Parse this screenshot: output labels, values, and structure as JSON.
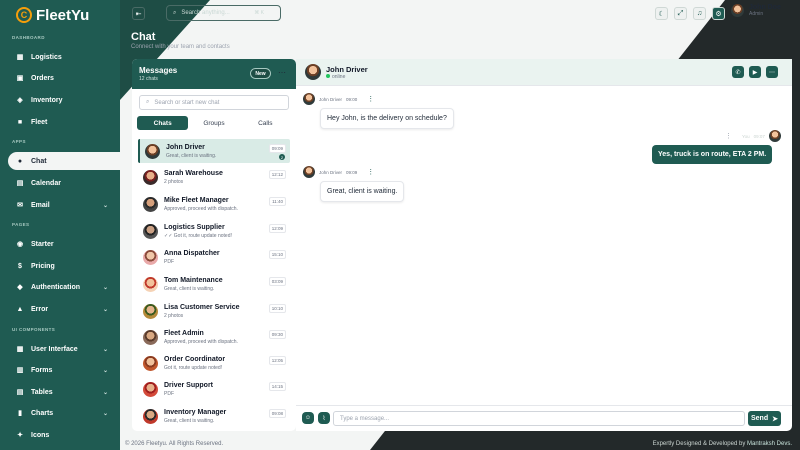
{
  "brand": {
    "name": "FleetYu",
    "mark": "C"
  },
  "sidebar": {
    "sections": [
      "DASHBOARD",
      "APPS",
      "PAGES",
      "UI COMPONENTS"
    ],
    "items": [
      {
        "label": "Logistics",
        "icon": "building-icon"
      },
      {
        "label": "Orders",
        "icon": "box-icon"
      },
      {
        "label": "Inventory",
        "icon": "layers-icon"
      },
      {
        "label": "Fleet",
        "icon": "truck-icon"
      },
      {
        "label": "Chat",
        "icon": "chat-icon",
        "active": true
      },
      {
        "label": "Calendar",
        "icon": "calendar-icon"
      },
      {
        "label": "Email",
        "icon": "mail-icon",
        "expandable": true
      },
      {
        "label": "Starter",
        "icon": "rocket-icon"
      },
      {
        "label": "Pricing",
        "icon": "dollar-icon"
      },
      {
        "label": "Authentication",
        "icon": "shield-icon",
        "expandable": true
      },
      {
        "label": "Error",
        "icon": "alert-icon",
        "expandable": true
      },
      {
        "label": "User Interface",
        "icon": "grid-icon",
        "expandable": true
      },
      {
        "label": "Forms",
        "icon": "form-icon",
        "expandable": true
      },
      {
        "label": "Tables",
        "icon": "table-icon",
        "expandable": true
      },
      {
        "label": "Charts",
        "icon": "chart-icon",
        "expandable": true
      },
      {
        "label": "Icons",
        "icon": "star-icon"
      }
    ]
  },
  "topbar": {
    "search_placeholder": "Search anything...",
    "shortcut": "⌘ K",
    "user": {
      "name": "John Doe",
      "role": "Admin"
    }
  },
  "page": {
    "title": "Chat",
    "subtitle": "Connect with your team and contacts"
  },
  "messages_panel": {
    "title": "Messages",
    "subtitle": "12 chats",
    "new_label": "New",
    "search_placeholder": "Search or start new chat",
    "tabs": [
      "Chats",
      "Groups",
      "Calls"
    ],
    "conversations": [
      {
        "name": "John Driver",
        "preview": "Great, client is waiting.",
        "time": "09:09",
        "badge": "2",
        "selected": true
      },
      {
        "name": "Sarah Warehouse",
        "preview": "2 photos",
        "time": "12:12"
      },
      {
        "name": "Mike Fleet Manager",
        "preview": "Approved, proceed with dispatch.",
        "time": "11:40"
      },
      {
        "name": "Logistics Supplier",
        "preview": "✓✓ Got it, route update noted!",
        "time": "12:09"
      },
      {
        "name": "Anna Dispatcher",
        "preview": "PDF",
        "time": "15:10"
      },
      {
        "name": "Tom Maintenance",
        "preview": "Great, client is waiting.",
        "time": "03:09"
      },
      {
        "name": "Lisa Customer Service",
        "preview": "2 photos",
        "time": "10:10"
      },
      {
        "name": "Fleet Admin",
        "preview": "Approved, proceed with dispatch.",
        "time": "09:30"
      },
      {
        "name": "Order Coordinator",
        "preview": "Got it, route update noted!",
        "time": "12:05"
      },
      {
        "name": "Driver Support",
        "preview": "PDF",
        "time": "14:15"
      },
      {
        "name": "Inventory Manager",
        "preview": "Great, client is waiting.",
        "time": "09:08"
      }
    ]
  },
  "chat": {
    "contact": {
      "name": "John Driver",
      "status": "online"
    },
    "messages": [
      {
        "from": "John Driver",
        "time": "09:00",
        "text": "Hey John, is the delivery on schedule?",
        "dir": "in"
      },
      {
        "from": "You",
        "time": "09:07",
        "text": "Yes, truck is on route, ETA 2 PM.",
        "dir": "out"
      },
      {
        "from": "John Driver",
        "time": "09:09",
        "text": "Great, client is waiting.",
        "dir": "in"
      }
    ],
    "input_placeholder": "Type a message...",
    "send_label": "Send"
  },
  "footer": {
    "copyright": "© 2026 Fleetyu. All Rights Reserved.",
    "credit_prefix": "Expertly Designed & Developed by",
    "credit_name": "Mantraksh Devs."
  },
  "colors": {
    "primary": "#1f5b52",
    "dark": "#23292a",
    "accent": "#f59e0b",
    "online": "#22c55e"
  }
}
